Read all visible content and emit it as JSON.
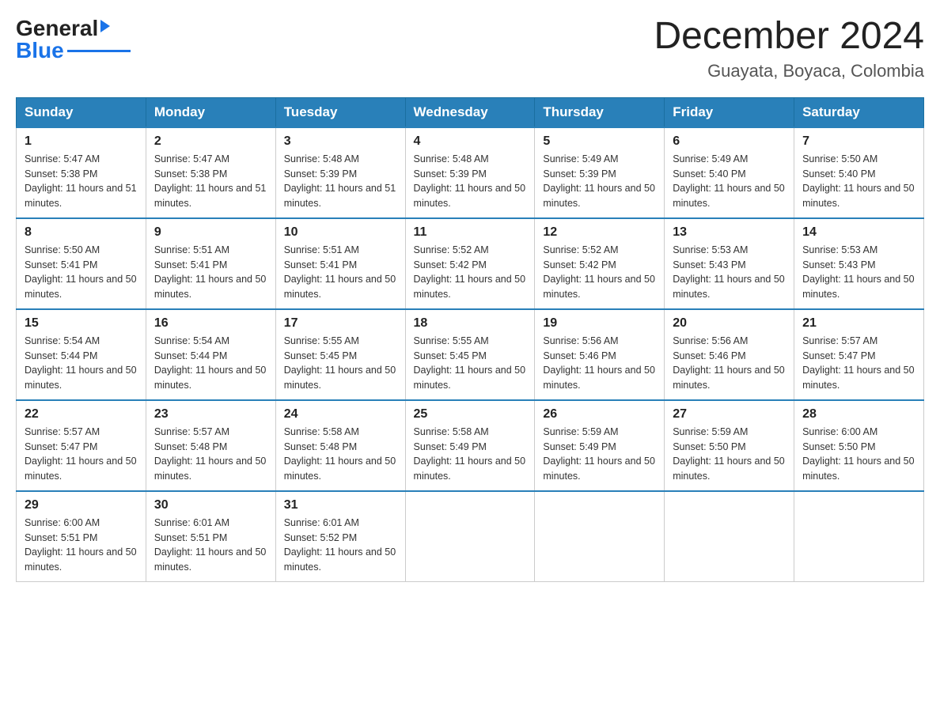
{
  "logo": {
    "text_general": "General",
    "text_blue": "Blue",
    "arrow": "▶"
  },
  "title": "December 2024",
  "subtitle": "Guayata, Boyaca, Colombia",
  "weekdays": [
    "Sunday",
    "Monday",
    "Tuesday",
    "Wednesday",
    "Thursday",
    "Friday",
    "Saturday"
  ],
  "weeks": [
    [
      {
        "day": "1",
        "sunrise": "5:47 AM",
        "sunset": "5:38 PM",
        "daylight": "11 hours and 51 minutes."
      },
      {
        "day": "2",
        "sunrise": "5:47 AM",
        "sunset": "5:38 PM",
        "daylight": "11 hours and 51 minutes."
      },
      {
        "day": "3",
        "sunrise": "5:48 AM",
        "sunset": "5:39 PM",
        "daylight": "11 hours and 51 minutes."
      },
      {
        "day": "4",
        "sunrise": "5:48 AM",
        "sunset": "5:39 PM",
        "daylight": "11 hours and 50 minutes."
      },
      {
        "day": "5",
        "sunrise": "5:49 AM",
        "sunset": "5:39 PM",
        "daylight": "11 hours and 50 minutes."
      },
      {
        "day": "6",
        "sunrise": "5:49 AM",
        "sunset": "5:40 PM",
        "daylight": "11 hours and 50 minutes."
      },
      {
        "day": "7",
        "sunrise": "5:50 AM",
        "sunset": "5:40 PM",
        "daylight": "11 hours and 50 minutes."
      }
    ],
    [
      {
        "day": "8",
        "sunrise": "5:50 AM",
        "sunset": "5:41 PM",
        "daylight": "11 hours and 50 minutes."
      },
      {
        "day": "9",
        "sunrise": "5:51 AM",
        "sunset": "5:41 PM",
        "daylight": "11 hours and 50 minutes."
      },
      {
        "day": "10",
        "sunrise": "5:51 AM",
        "sunset": "5:41 PM",
        "daylight": "11 hours and 50 minutes."
      },
      {
        "day": "11",
        "sunrise": "5:52 AM",
        "sunset": "5:42 PM",
        "daylight": "11 hours and 50 minutes."
      },
      {
        "day": "12",
        "sunrise": "5:52 AM",
        "sunset": "5:42 PM",
        "daylight": "11 hours and 50 minutes."
      },
      {
        "day": "13",
        "sunrise": "5:53 AM",
        "sunset": "5:43 PM",
        "daylight": "11 hours and 50 minutes."
      },
      {
        "day": "14",
        "sunrise": "5:53 AM",
        "sunset": "5:43 PM",
        "daylight": "11 hours and 50 minutes."
      }
    ],
    [
      {
        "day": "15",
        "sunrise": "5:54 AM",
        "sunset": "5:44 PM",
        "daylight": "11 hours and 50 minutes."
      },
      {
        "day": "16",
        "sunrise": "5:54 AM",
        "sunset": "5:44 PM",
        "daylight": "11 hours and 50 minutes."
      },
      {
        "day": "17",
        "sunrise": "5:55 AM",
        "sunset": "5:45 PM",
        "daylight": "11 hours and 50 minutes."
      },
      {
        "day": "18",
        "sunrise": "5:55 AM",
        "sunset": "5:45 PM",
        "daylight": "11 hours and 50 minutes."
      },
      {
        "day": "19",
        "sunrise": "5:56 AM",
        "sunset": "5:46 PM",
        "daylight": "11 hours and 50 minutes."
      },
      {
        "day": "20",
        "sunrise": "5:56 AM",
        "sunset": "5:46 PM",
        "daylight": "11 hours and 50 minutes."
      },
      {
        "day": "21",
        "sunrise": "5:57 AM",
        "sunset": "5:47 PM",
        "daylight": "11 hours and 50 minutes."
      }
    ],
    [
      {
        "day": "22",
        "sunrise": "5:57 AM",
        "sunset": "5:47 PM",
        "daylight": "11 hours and 50 minutes."
      },
      {
        "day": "23",
        "sunrise": "5:57 AM",
        "sunset": "5:48 PM",
        "daylight": "11 hours and 50 minutes."
      },
      {
        "day": "24",
        "sunrise": "5:58 AM",
        "sunset": "5:48 PM",
        "daylight": "11 hours and 50 minutes."
      },
      {
        "day": "25",
        "sunrise": "5:58 AM",
        "sunset": "5:49 PM",
        "daylight": "11 hours and 50 minutes."
      },
      {
        "day": "26",
        "sunrise": "5:59 AM",
        "sunset": "5:49 PM",
        "daylight": "11 hours and 50 minutes."
      },
      {
        "day": "27",
        "sunrise": "5:59 AM",
        "sunset": "5:50 PM",
        "daylight": "11 hours and 50 minutes."
      },
      {
        "day": "28",
        "sunrise": "6:00 AM",
        "sunset": "5:50 PM",
        "daylight": "11 hours and 50 minutes."
      }
    ],
    [
      {
        "day": "29",
        "sunrise": "6:00 AM",
        "sunset": "5:51 PM",
        "daylight": "11 hours and 50 minutes."
      },
      {
        "day": "30",
        "sunrise": "6:01 AM",
        "sunset": "5:51 PM",
        "daylight": "11 hours and 50 minutes."
      },
      {
        "day": "31",
        "sunrise": "6:01 AM",
        "sunset": "5:52 PM",
        "daylight": "11 hours and 50 minutes."
      },
      null,
      null,
      null,
      null
    ]
  ]
}
